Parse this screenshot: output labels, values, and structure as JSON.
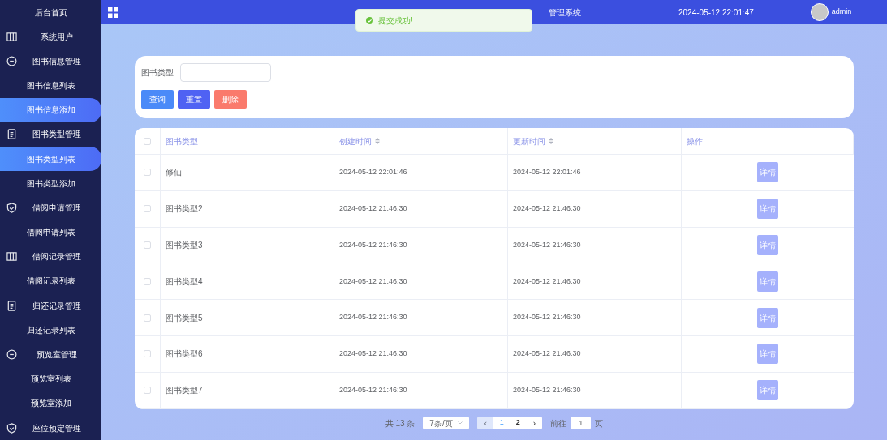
{
  "sidebar": {
    "items": [
      {
        "label": "后台首页",
        "kind": "link",
        "selected": false
      },
      {
        "label": "系统用户",
        "kind": "group",
        "selected": false
      },
      {
        "label": "图书信息管理",
        "kind": "group",
        "selected": false
      },
      {
        "label": "图书信息列表",
        "kind": "link",
        "selected": false
      },
      {
        "label": "图书信息添加",
        "kind": "link",
        "selected": true
      },
      {
        "label": "图书类型管理",
        "kind": "group",
        "selected": false
      },
      {
        "label": "图书类型列表",
        "kind": "link",
        "selected": true
      },
      {
        "label": "图书类型添加",
        "kind": "link",
        "selected": false
      },
      {
        "label": "借阅申请管理",
        "kind": "group",
        "selected": false
      },
      {
        "label": "借阅申请列表",
        "kind": "link",
        "selected": false
      },
      {
        "label": "借阅记录管理",
        "kind": "group",
        "selected": false
      },
      {
        "label": "借阅记录列表",
        "kind": "link",
        "selected": false
      },
      {
        "label": "归还记录管理",
        "kind": "group",
        "selected": false
      },
      {
        "label": "归还记录列表",
        "kind": "link",
        "selected": false
      },
      {
        "label": "预览室管理",
        "kind": "group",
        "selected": false
      },
      {
        "label": "预览室列表",
        "kind": "link",
        "selected": false
      },
      {
        "label": "预览室添加",
        "kind": "link",
        "selected": false
      },
      {
        "label": "座位预定管理",
        "kind": "group",
        "selected": false
      }
    ]
  },
  "header": {
    "title": "管理系统",
    "datetime": "2024-05-12 22:01:47",
    "user": "admin"
  },
  "toast": {
    "message": "提交成功!"
  },
  "search": {
    "label": "图书类型",
    "buttons": [
      {
        "label": "查询",
        "kind": "primary"
      },
      {
        "label": "重置",
        "kind": "secondary"
      },
      {
        "label": "删除",
        "kind": "danger"
      }
    ]
  },
  "table": {
    "columns": [
      {
        "label": "图书类型",
        "sortable": false
      },
      {
        "label": "创建时间",
        "sortable": true
      },
      {
        "label": "更新时间",
        "sortable": true
      },
      {
        "label": "操作",
        "sortable": false
      }
    ],
    "rows": [
      {
        "checked": false,
        "type": "修仙",
        "created": "2024-05-12 22:01:46",
        "updated": "2024-05-12 22:01:46",
        "action": "详情"
      },
      {
        "checked": false,
        "type": "图书类型2",
        "created": "2024-05-12 21:46:30",
        "updated": "2024-05-12 21:46:30",
        "action": "详情"
      },
      {
        "checked": false,
        "type": "图书类型3",
        "created": "2024-05-12 21:46:30",
        "updated": "2024-05-12 21:46:30",
        "action": "详情"
      },
      {
        "checked": false,
        "type": "图书类型4",
        "created": "2024-05-12 21:46:30",
        "updated": "2024-05-12 21:46:30",
        "action": "详情"
      },
      {
        "checked": false,
        "type": "图书类型5",
        "created": "2024-05-12 21:46:30",
        "updated": "2024-05-12 21:46:30",
        "action": "详情"
      },
      {
        "checked": false,
        "type": "图书类型6",
        "created": "2024-05-12 21:46:30",
        "updated": "2024-05-12 21:46:30",
        "action": "详情"
      },
      {
        "checked": false,
        "type": "图书类型7",
        "created": "2024-05-12 21:46:30",
        "updated": "2024-05-12 21:46:30",
        "action": "详情"
      }
    ]
  },
  "pagination": {
    "total": "共 13 条",
    "page_size": "7条/页",
    "prev": "‹",
    "next": "›",
    "pages": [
      {
        "label": "1",
        "selected": true
      },
      {
        "label": "2",
        "selected": false
      }
    ],
    "goto_label": "前往",
    "goto_value": "1",
    "goto_suffix": "页"
  }
}
